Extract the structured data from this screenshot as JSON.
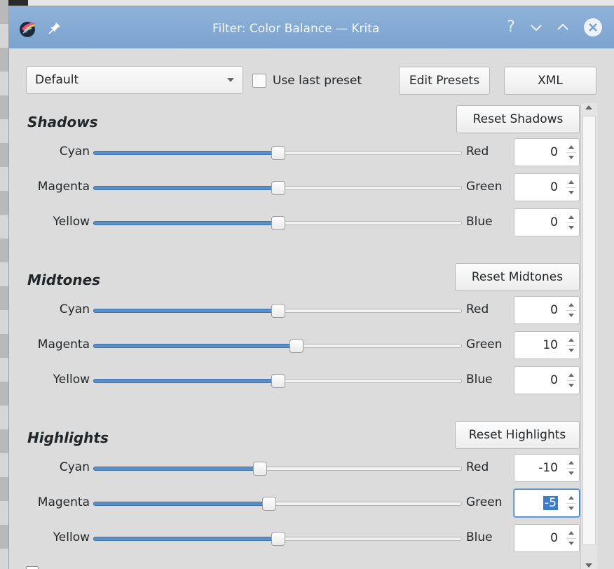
{
  "window": {
    "title": "Filter: Color Balance — Krita",
    "help_glyph": "?",
    "minimize_glyph": "⌵",
    "maximize_glyph": "⌃",
    "close_glyph": "✕"
  },
  "toolbar": {
    "preset_value": "Default",
    "use_last_preset_label": "Use last preset",
    "use_last_preset_checked": false,
    "edit_presets_label": "Edit Presets",
    "xml_label": "XML"
  },
  "sections": [
    {
      "title": "Shadows",
      "reset_label": "Reset Shadows",
      "rows": [
        {
          "left": "Cyan",
          "right": "Red",
          "value": "0"
        },
        {
          "left": "Magenta",
          "right": "Green",
          "value": "0"
        },
        {
          "left": "Yellow",
          "right": "Blue",
          "value": "0"
        }
      ]
    },
    {
      "title": "Midtones",
      "reset_label": "Reset Midtones",
      "rows": [
        {
          "left": "Cyan",
          "right": "Red",
          "value": "0"
        },
        {
          "left": "Magenta",
          "right": "Green",
          "value": "10"
        },
        {
          "left": "Yellow",
          "right": "Blue",
          "value": "0"
        }
      ]
    },
    {
      "title": "Highlights",
      "reset_label": "Reset Highlights",
      "rows": [
        {
          "left": "Cyan",
          "right": "Red",
          "value": "-10"
        },
        {
          "left": "Magenta",
          "right": "Green",
          "value": "-5"
        },
        {
          "left": "Yellow",
          "right": "Blue",
          "value": "0"
        }
      ]
    }
  ],
  "slider_range": [
    -100,
    100
  ],
  "bottom": {
    "preserve_luminosity_checked": true
  },
  "colors": {
    "titlebar": "#7ba3cf",
    "slider_fill": "#5b8fc6",
    "focus": "#3d7cc9"
  }
}
